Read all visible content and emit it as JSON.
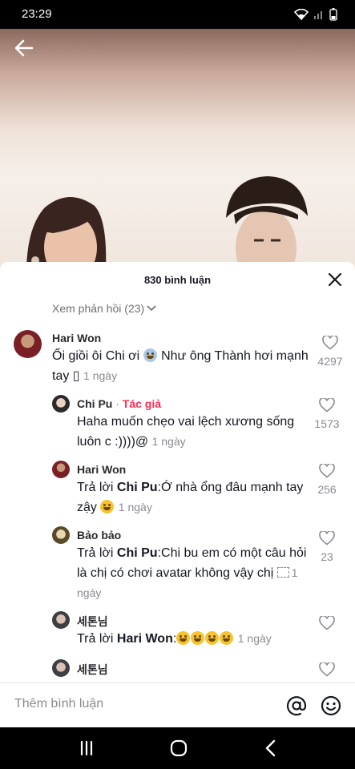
{
  "status": {
    "time": "23:29"
  },
  "sheet": {
    "title": "830 bình luận",
    "view_replies": "Xem phản hồi (23)"
  },
  "comments": [
    {
      "name": "Hari Won",
      "text_a": "Ối giồi ôi Chi ơi ",
      "text_b": " Như ông Thành hơi mạnh tay ▯",
      "time": "1 ngày",
      "likes": "4297"
    },
    {
      "name": "Chi Pu",
      "sep": " · ",
      "author_tag": "Tác giả",
      "text": "Haha muốn chẹo vai lệch xương sống luôn c :))))@",
      "time": "1 ngày",
      "likes": "1573"
    },
    {
      "name": "Hari Won",
      "reply_prefix": "Trả lời ",
      "reply_to": "Chi Pu",
      "text": ":Ớ nhà ổng đâu mạnh tay zậy ",
      "time": "1 ngày",
      "likes": "256"
    },
    {
      "name": "Bảo bảo",
      "reply_prefix": "Trả lời ",
      "reply_to": "Chi Pu",
      "text": ":Chi bu em có một câu hỏi là chị có chơi avatar không vậy chị",
      "time": "1 ngày",
      "likes": "23"
    },
    {
      "name": "세톤님",
      "reply_prefix": "Trả lời ",
      "reply_to": "Hari Won",
      "text": ":",
      "time": "1 ngày",
      "likes": ""
    },
    {
      "name": "세톤님",
      "likes": ""
    }
  ],
  "input": {
    "placeholder": "Thêm bình luận"
  },
  "colors": {
    "author_tag": "#fe2c55",
    "text": "#161823",
    "muted": "#8a8b91"
  }
}
